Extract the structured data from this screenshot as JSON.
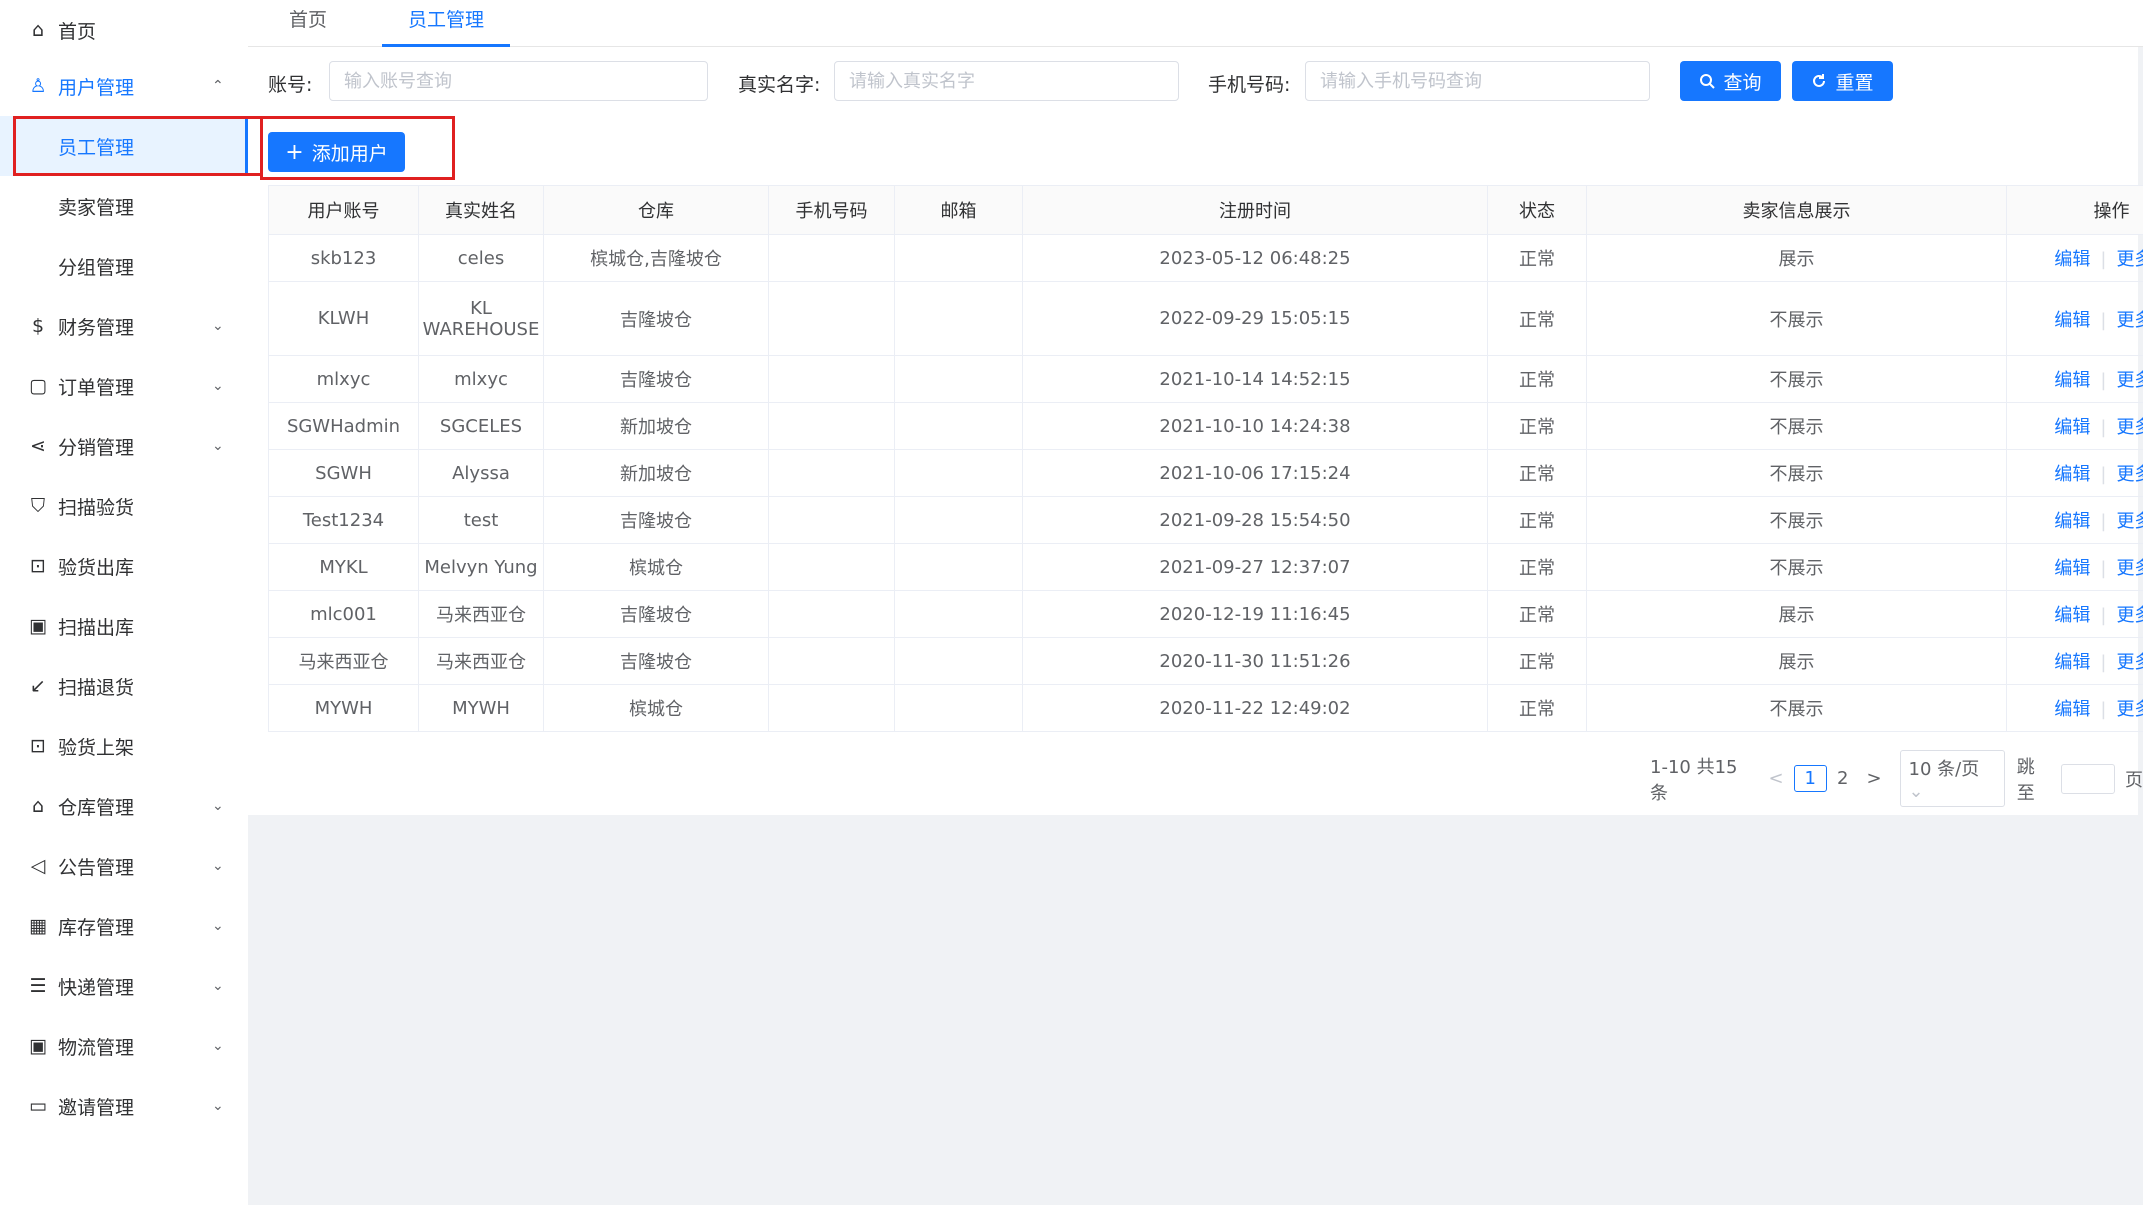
{
  "sidebar": {
    "items": [
      {
        "label": "首页",
        "icon": "home-icon"
      },
      {
        "label": "用户管理",
        "icon": "user-icon",
        "arrow": "⌃"
      },
      {
        "label": "员工管理"
      },
      {
        "label": "卖家管理"
      },
      {
        "label": "分组管理"
      },
      {
        "label": "财务管理",
        "icon": "finance-icon",
        "arrow": "⌄"
      },
      {
        "label": "订单管理",
        "icon": "bag-icon",
        "arrow": "⌄"
      },
      {
        "label": "分销管理",
        "icon": "share-icon",
        "arrow": "⌄"
      },
      {
        "label": "扫描验货",
        "icon": "shield-icon"
      },
      {
        "label": "验货出库",
        "icon": "scan-icon"
      },
      {
        "label": "扫描出库",
        "icon": "truck-icon"
      },
      {
        "label": "扫描退货",
        "icon": "return-icon"
      },
      {
        "label": "验货上架",
        "icon": "scan-icon"
      },
      {
        "label": "仓库管理",
        "icon": "warehouse-icon",
        "arrow": "⌄"
      },
      {
        "label": "公告管理",
        "icon": "megaphone-icon",
        "arrow": "⌄"
      },
      {
        "label": "库存管理",
        "icon": "grid-icon",
        "arrow": "⌄"
      },
      {
        "label": "快递管理",
        "icon": "list-icon",
        "arrow": "⌄"
      },
      {
        "label": "物流管理",
        "icon": "truck-icon",
        "arrow": "⌄"
      },
      {
        "label": "邀请管理",
        "icon": "card-icon",
        "arrow": "⌄"
      }
    ]
  },
  "tabs": [
    {
      "label": "首页"
    },
    {
      "label": "员工管理"
    }
  ],
  "search": {
    "account_label": "账号:",
    "account_placeholder": "输入账号查询",
    "name_label": "真实名字:",
    "name_placeholder": "请输入真实名字",
    "phone_label": "手机号码:",
    "phone_placeholder": "请输入手机号码查询",
    "query_button": "查询",
    "reset_button": "重置"
  },
  "toolbar": {
    "add_user_button": "添加用户"
  },
  "table": {
    "headers": [
      "用户账号",
      "真实姓名",
      "仓库",
      "手机号码",
      "邮箱",
      "注册时间",
      "状态",
      "卖家信息展示",
      "操作"
    ],
    "rows": [
      {
        "account": "skb123",
        "name": "celes",
        "warehouse": "槟城仓,吉隆坡仓",
        "phone": "",
        "email": "",
        "time": "2023-05-12 06:48:25",
        "status": "正常",
        "display": "展示"
      },
      {
        "account": "KLWH",
        "name": "KL WAREHOUSE",
        "warehouse": "吉隆坡仓",
        "phone": "",
        "email": "",
        "time": "2022-09-29 15:05:15",
        "status": "正常",
        "display": "不展示"
      },
      {
        "account": "mlxyc",
        "name": "mlxyc",
        "warehouse": "吉隆坡仓",
        "phone": "",
        "email": "",
        "time": "2021-10-14 14:52:15",
        "status": "正常",
        "display": "不展示"
      },
      {
        "account": "SGWHadmin",
        "name": "SGCELES",
        "warehouse": "新加坡仓",
        "phone": "",
        "email": "",
        "time": "2021-10-10 14:24:38",
        "status": "正常",
        "display": "不展示"
      },
      {
        "account": "SGWH",
        "name": "Alyssa",
        "warehouse": "新加坡仓",
        "phone": "",
        "email": "",
        "time": "2021-10-06 17:15:24",
        "status": "正常",
        "display": "不展示"
      },
      {
        "account": "Test1234",
        "name": "test",
        "warehouse": "吉隆坡仓",
        "phone": "",
        "email": "",
        "time": "2021-09-28 15:54:50",
        "status": "正常",
        "display": "不展示"
      },
      {
        "account": "MYKL",
        "name": "Melvyn Yung",
        "warehouse": "槟城仓",
        "phone": "",
        "email": "",
        "time": "2021-09-27 12:37:07",
        "status": "正常",
        "display": "不展示"
      },
      {
        "account": "mlc001",
        "name": "马来西亚仓",
        "warehouse": "吉隆坡仓",
        "phone": "",
        "email": "",
        "time": "2020-12-19 11:16:45",
        "status": "正常",
        "display": "展示"
      },
      {
        "account": "马来西亚仓",
        "name": "马来西亚仓",
        "warehouse": "吉隆坡仓",
        "phone": "",
        "email": "",
        "time": "2020-11-30 11:51:26",
        "status": "正常",
        "display": "展示"
      },
      {
        "account": "MYWH",
        "name": "MYWH",
        "warehouse": "槟城仓",
        "phone": "",
        "email": "",
        "time": "2020-11-22 12:49:02",
        "status": "正常",
        "display": "不展示"
      }
    ],
    "edit_label": "编辑",
    "more_label": "更多"
  },
  "pager": {
    "summary": "1-10 共15条",
    "prev": "<",
    "pages": [
      "1",
      "2"
    ],
    "next": ">",
    "size": "10 条/页",
    "jump_label": "跳至",
    "page_suffix": "页"
  },
  "colors": {
    "accent": "#1677ff",
    "highlight": "#e02020"
  }
}
